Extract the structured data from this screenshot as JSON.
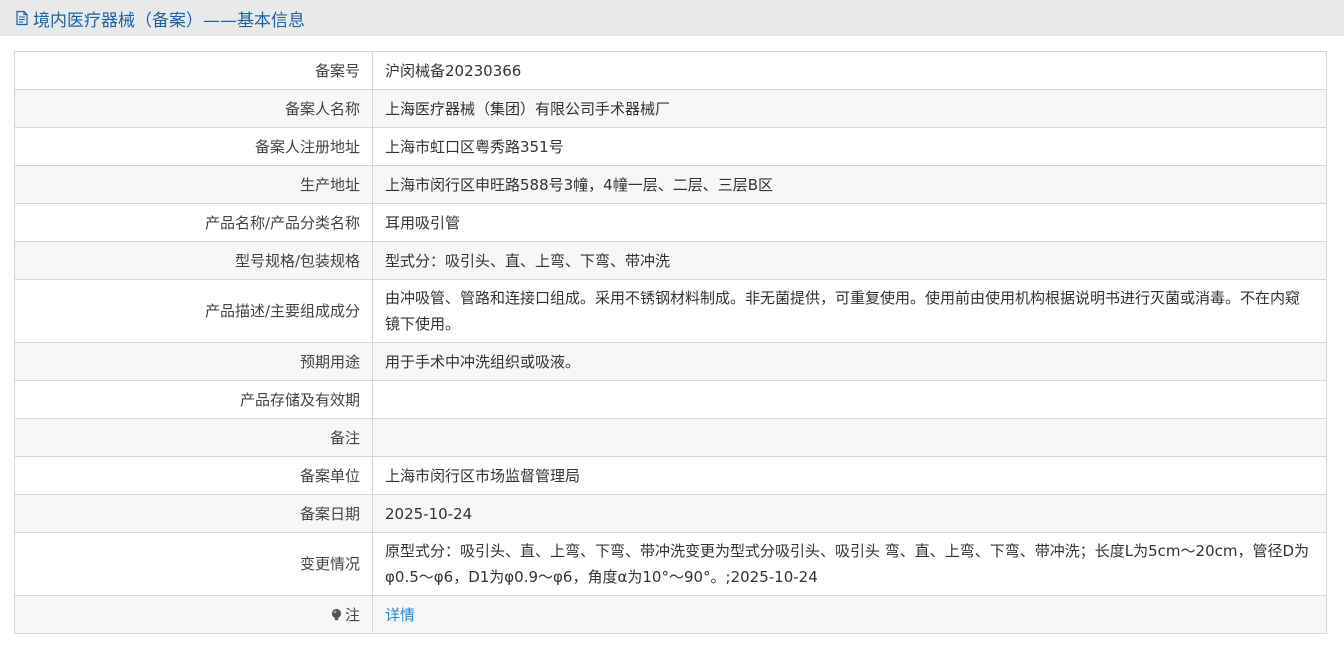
{
  "header": {
    "title": "境内医疗器械（备案）——基本信息",
    "icon": "document-icon",
    "color": "#1a63a8"
  },
  "rows": [
    {
      "label": "备案号",
      "value": "沪闵械备20230366"
    },
    {
      "label": "备案人名称",
      "value": "上海医疗器械（集团）有限公司手术器械厂"
    },
    {
      "label": "备案人注册地址",
      "value": "上海市虹口区粤秀路351号"
    },
    {
      "label": "生产地址",
      "value": "上海市闵行区申旺路588号3幢，4幢一层、二层、三层B区"
    },
    {
      "label": "产品名称/产品分类名称",
      "value": "耳用吸引管"
    },
    {
      "label": "型号规格/包装规格",
      "value": "型式分：吸引头、直、上弯、下弯、带冲洗"
    },
    {
      "label": "产品描述/主要组成成分",
      "value": "由冲吸管、管路和连接口组成。采用不锈钢材料制成。非无菌提供，可重复使用。使用前由使用机构根据说明书进行灭菌或消毒。不在内窥镜下使用。"
    },
    {
      "label": "预期用途",
      "value": "用于手术中冲洗组织或吸液。"
    },
    {
      "label": "产品存储及有效期",
      "value": ""
    },
    {
      "label": "备注",
      "value": ""
    },
    {
      "label": "备案单位",
      "value": "上海市闵行区市场监督管理局"
    },
    {
      "label": "备案日期",
      "value": "2025-10-24"
    },
    {
      "label": "变更情况",
      "value": "原型式分：吸引头、直、上弯、下弯、带冲洗变更为型式分吸引头、吸引头 弯、直、上弯、下弯、带冲洗；长度L为5cm～20cm，管径D为φ0.5～φ6，D1为φ0.9～φ6，角度α为10°～90°。;2025-10-24"
    },
    {
      "label": "注",
      "value": "详情",
      "label_icon": "lightbulb-icon",
      "link_color": "#1e88d8"
    }
  ]
}
